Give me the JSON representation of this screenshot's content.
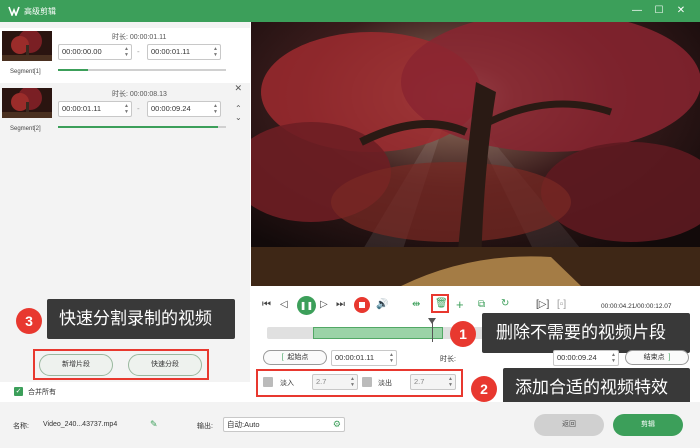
{
  "window": {
    "title": "高级剪辑",
    "minimize_icon": "—",
    "restore_icon": "☐",
    "close_icon": "✕"
  },
  "segments": [
    {
      "label": "Segment[1]",
      "duration_label": "时长: 00:00:01.11",
      "start": "00:00:00.00",
      "end": "00:00:01.11",
      "dash": "-",
      "progress": 0.18
    },
    {
      "label": "Segment[2]",
      "duration_label": "时长: 00:00:08.13",
      "start": "00:00:01.11",
      "end": "00:00:09.24",
      "dash": "-",
      "progress": 0.95
    }
  ],
  "annotations": {
    "c1": {
      "num": "1",
      "text": "删除不需要的视频片段"
    },
    "c2": {
      "num": "2",
      "text": "添加合适的视频特效"
    },
    "c3": {
      "num": "3",
      "text": "快速分割录制的视频"
    }
  },
  "left_buttons": {
    "add_segment": "新增片段",
    "quick_split": "快速分段"
  },
  "merge_all": "合并所有",
  "playback": {
    "time": "00:00:04.21/00:00:12.07"
  },
  "trim": {
    "start_btn": "起始点",
    "start_value": "00:00:01.11",
    "duration_label": "时长:",
    "end_value": "00:00:09.24",
    "end_btn": "结束点"
  },
  "effects": {
    "fade_in_label": "淡入",
    "fade_in_value": "2.7",
    "fade_out_label": "淡出",
    "fade_out_value": "2.7"
  },
  "bottom": {
    "name_label": "名称:",
    "name_value": "Video_240...43737.mp4",
    "output_label": "输出:",
    "output_value": "自动:Auto",
    "back_button": "返回",
    "clip_button": "剪辑"
  },
  "colors": {
    "accent": "#3c9f5a",
    "callout_bg": "#393939",
    "annotation_red": "#e8382f"
  }
}
